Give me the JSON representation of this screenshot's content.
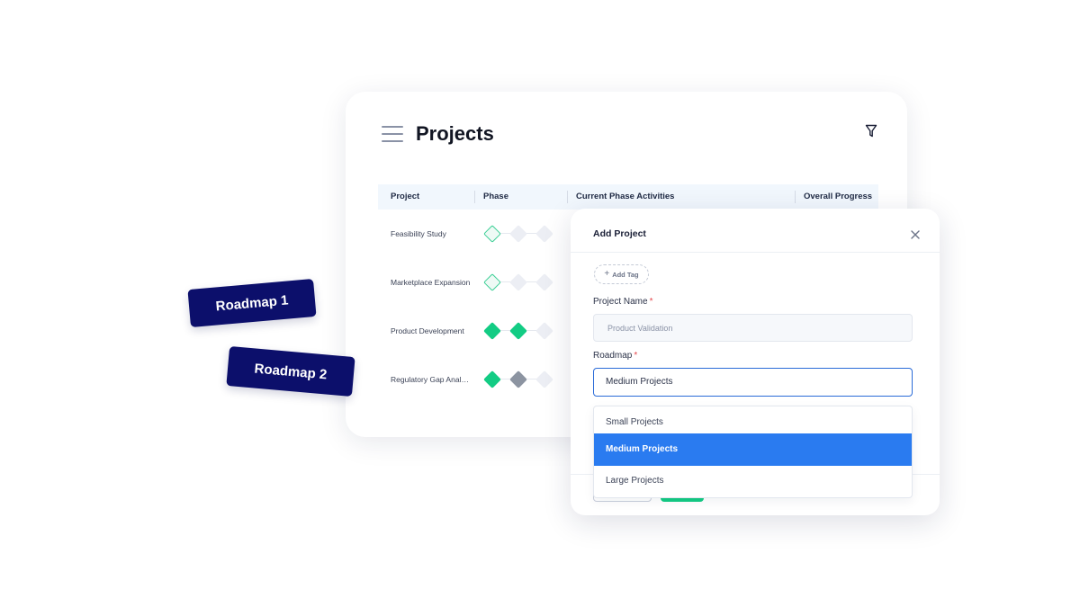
{
  "projects": {
    "title": "Projects",
    "columns": [
      "Project",
      "Phase",
      "Current Phase Activities",
      "Overall Progress"
    ],
    "rows": [
      {
        "name": "Feasibility Study",
        "phases": [
          "current",
          "pending",
          "pending"
        ]
      },
      {
        "name": "Marketplace Expansion",
        "phases": [
          "current",
          "pending",
          "pending"
        ]
      },
      {
        "name": "Product Development",
        "phases": [
          "done",
          "done",
          "pending"
        ]
      },
      {
        "name": "Regulatory Gap Analysis",
        "phases": [
          "done",
          "dark",
          "pending"
        ]
      }
    ]
  },
  "tags": {
    "roadmap_1": "Roadmap 1",
    "roadmap_2": "Roadmap 2"
  },
  "modal": {
    "title": "Add Project",
    "add_tag_label": "Add Tag",
    "project_name_label": "Project Name",
    "project_name_placeholder": "Product Validation",
    "roadmap_label": "Roadmap",
    "required_marker": "*",
    "roadmap_selected": "Medium Projects",
    "roadmap_options": [
      "Small Projects",
      "Medium Projects",
      "Large Projects"
    ]
  },
  "icons": {
    "menu": "menu-icon",
    "filter": "filter-icon",
    "close": "close-icon",
    "plus": "plus-icon"
  },
  "colors": {
    "accent_blue": "#2a7bf0",
    "success_green": "#13cc84",
    "tag_navy": "#0c0f6b",
    "required_red": "#e5484d"
  }
}
